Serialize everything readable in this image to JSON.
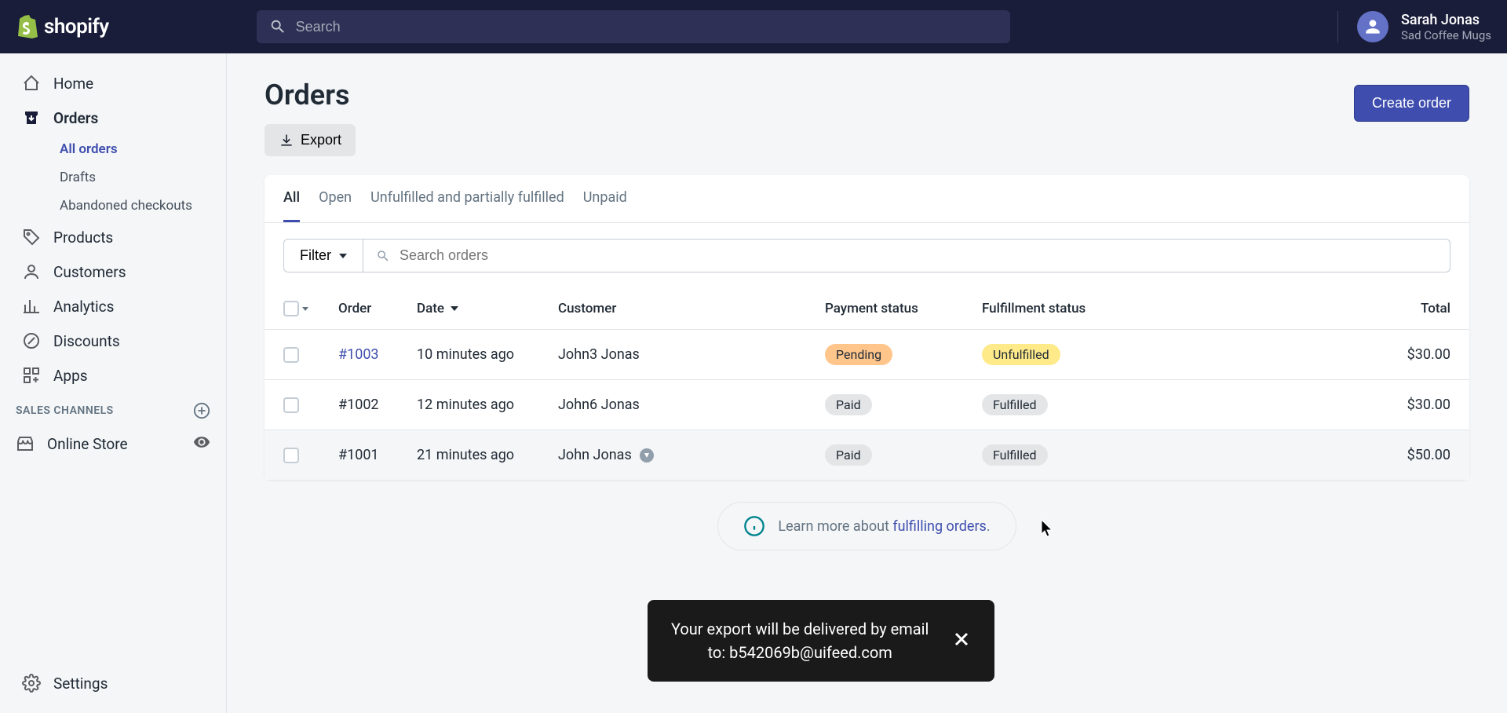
{
  "header": {
    "logo_text": "shopify",
    "search_placeholder": "Search",
    "user_name": "Sarah Jonas",
    "shop_name": "Sad Coffee Mugs"
  },
  "sidebar": {
    "items": [
      {
        "label": "Home",
        "icon": "home"
      },
      {
        "label": "Orders",
        "icon": "orders",
        "active": true
      },
      {
        "label": "Products",
        "icon": "products"
      },
      {
        "label": "Customers",
        "icon": "customers"
      },
      {
        "label": "Analytics",
        "icon": "analytics"
      },
      {
        "label": "Discounts",
        "icon": "discounts"
      },
      {
        "label": "Apps",
        "icon": "apps"
      }
    ],
    "order_sub": [
      {
        "label": "All orders",
        "active": true
      },
      {
        "label": "Drafts"
      },
      {
        "label": "Abandoned checkouts"
      }
    ],
    "section_label": "SALES CHANNELS",
    "channel": {
      "label": "Online Store"
    },
    "settings_label": "Settings"
  },
  "page": {
    "title": "Orders",
    "export_label": "Export",
    "create_label": "Create order"
  },
  "tabs": [
    "All",
    "Open",
    "Unfulfilled and partially fulfilled",
    "Unpaid"
  ],
  "filter": {
    "button_label": "Filter",
    "search_placeholder": "Search orders"
  },
  "table": {
    "headers": {
      "order": "Order",
      "date": "Date",
      "customer": "Customer",
      "payment": "Payment status",
      "fulfillment": "Fulfillment status",
      "total": "Total"
    },
    "rows": [
      {
        "id": "#1003",
        "id_link": true,
        "date": "10 minutes ago",
        "customer": "John3 Jonas",
        "has_note": false,
        "payment": "Pending",
        "payment_style": "pending",
        "fulfillment": "Unfulfilled",
        "fulfillment_style": "unfulfilled",
        "total": "$30.00"
      },
      {
        "id": "#1002",
        "id_link": false,
        "date": "12 minutes ago",
        "customer": "John6 Jonas",
        "has_note": false,
        "payment": "Paid",
        "payment_style": "paid",
        "fulfillment": "Fulfilled",
        "fulfillment_style": "fulfilled",
        "total": "$30.00"
      },
      {
        "id": "#1001",
        "id_link": false,
        "date": "21 minutes ago",
        "customer": "John Jonas",
        "has_note": true,
        "payment": "Paid",
        "payment_style": "paid",
        "fulfillment": "Fulfilled",
        "fulfillment_style": "fulfilled",
        "total": "$50.00"
      }
    ]
  },
  "help": {
    "prefix": "Learn more about ",
    "link": "fulfilling orders",
    "suffix": "."
  },
  "toast": {
    "line1": "Your export will be delivered by email",
    "line2": "to: b542069b@uifeed.com"
  }
}
